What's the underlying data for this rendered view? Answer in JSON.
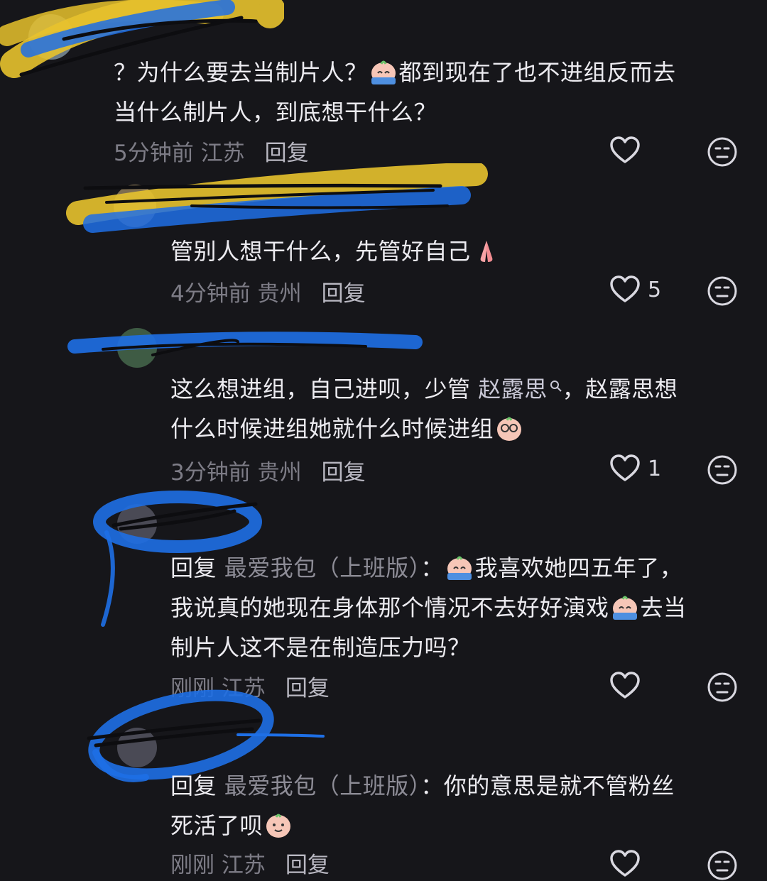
{
  "comments": [
    {
      "text_parts": [
        "？为什么要去当制片人？",
        "都到现在了也不进组反而去",
        "当什么制片人，到底想干什么？"
      ],
      "time": "5分钟前",
      "location": "江苏",
      "reply_label": "回复",
      "likes": ""
    },
    {
      "text_parts": [
        "管别人想干什么，先管好自己"
      ],
      "time": "4分钟前",
      "location": "贵州",
      "reply_label": "回复",
      "likes": "5"
    },
    {
      "text_parts": [
        "这么想进组，自己进呗，少管 ",
        "赵露思",
        "，赵露思想",
        "什么时候进组她就什么时候进组"
      ],
      "time": "3分钟前",
      "location": "贵州",
      "reply_label": "回复",
      "likes": "1"
    },
    {
      "reply_prefix": "回复",
      "reply_to": "最爱我包（上班版）",
      "colon": "：",
      "text_parts": [
        "我喜欢她四五年了，",
        "我说真的她现在身体那个情况不去好好演戏",
        "去当",
        "制片人这不是在制造压力吗？"
      ],
      "time": "刚刚",
      "location": "江苏",
      "reply_label": "回复",
      "likes": ""
    },
    {
      "reply_prefix": "回复",
      "reply_to": "最爱我包（上班版）",
      "colon": "：",
      "text_parts": [
        "你的意思是就不管粉丝",
        "死活了呗"
      ],
      "time": "刚刚",
      "location": "江苏",
      "reply_label": "回复",
      "likes": ""
    }
  ],
  "icons": {
    "like": "heart-outline-icon",
    "dislike": "neutral-face-icon",
    "search": "search-icon"
  },
  "colors": {
    "background": "#16161a",
    "text": "#ecebf0",
    "meta": "#7d7c86",
    "scribble_blue": "#1e6fe6",
    "scribble_yellow": "#e7c22d"
  }
}
